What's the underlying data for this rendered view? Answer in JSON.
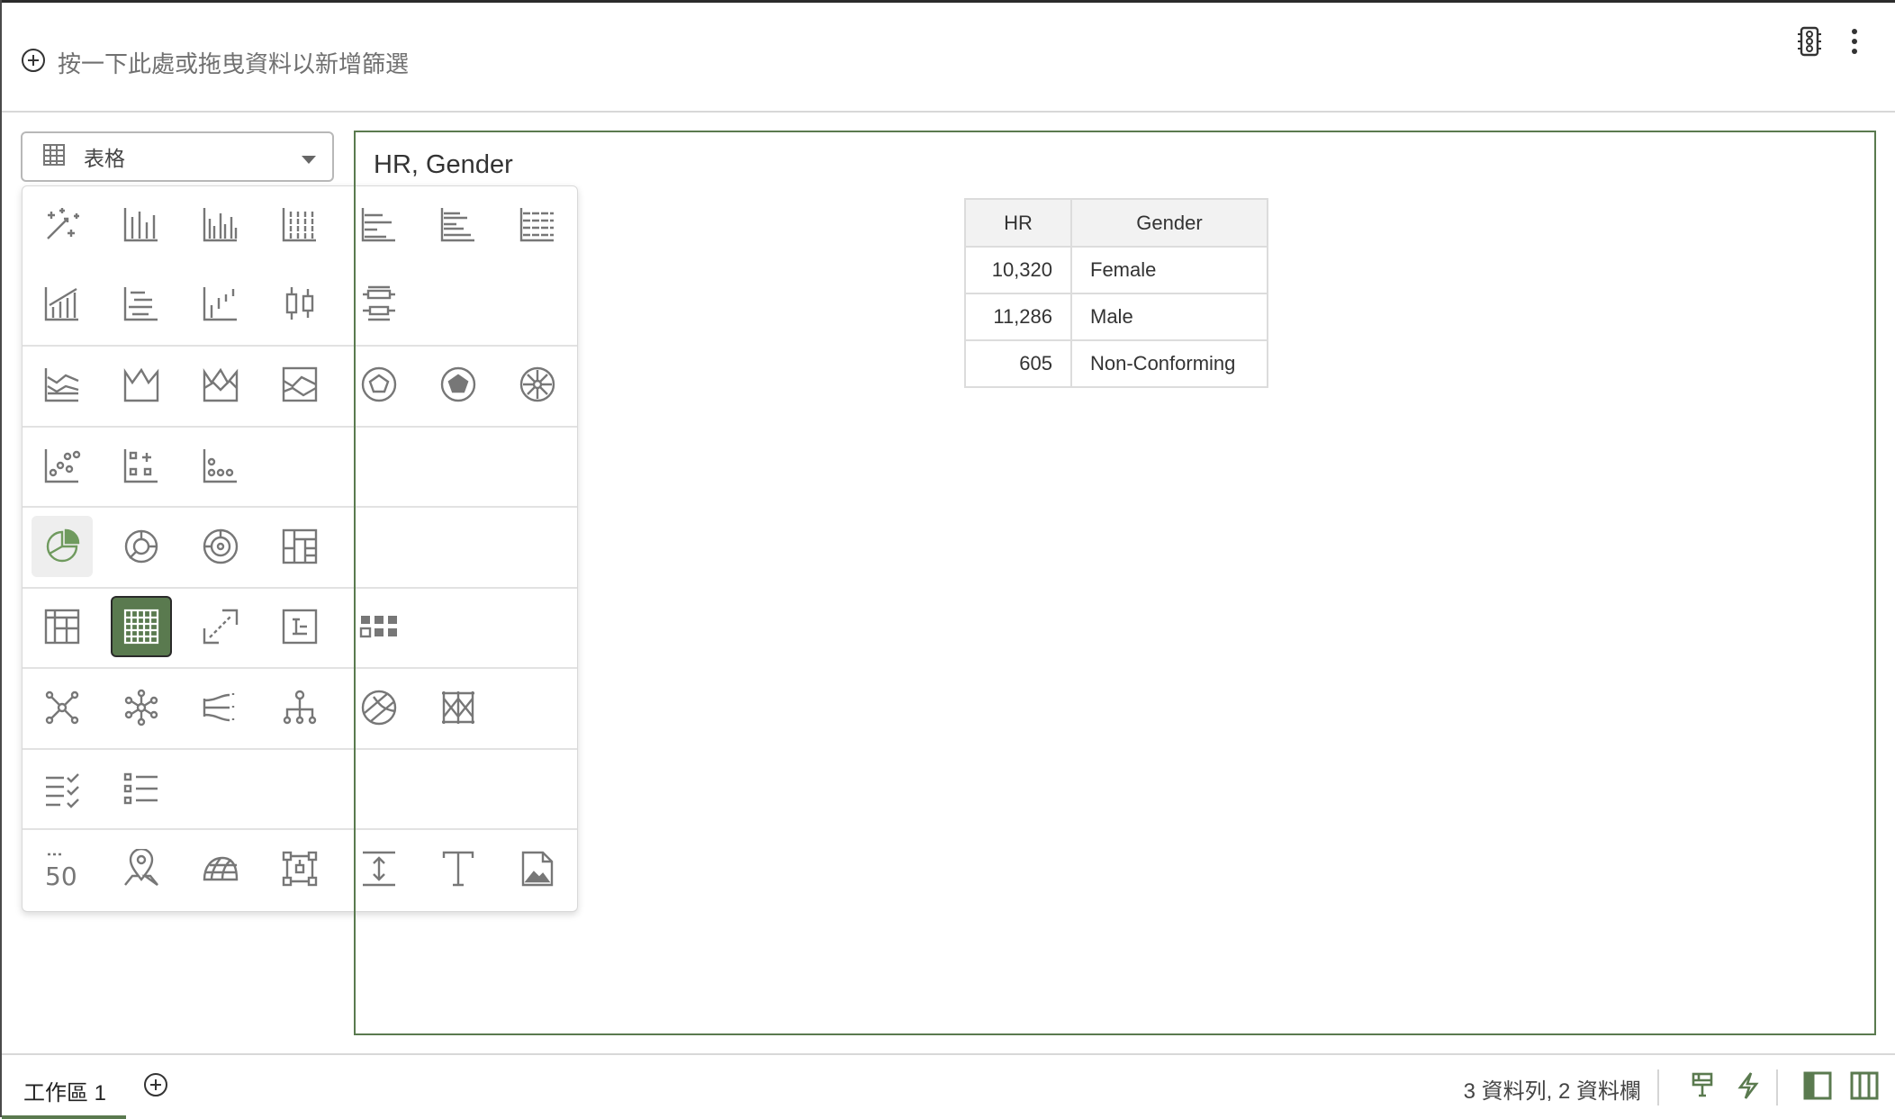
{
  "filter_bar": {
    "add_filter_text": "按一下此處或拖曳資料以新增篩選",
    "icons": [
      "add-circle-icon",
      "traffic-light-icon",
      "more-vertical-icon"
    ]
  },
  "viz_selector": {
    "selected_label": "表格",
    "icon": "table-grid-icon",
    "caret_icon": "chevron-down-icon"
  },
  "viz_panel": {
    "rows": [
      [
        "auto-visualization-icon",
        "bar-chart-icon",
        "grouped-bar-icon",
        "stacked-bar-icon",
        "horizontal-bar-icon",
        "horizontal-grouped-bar-icon",
        "horizontal-stacked-bar-icon"
      ],
      [
        "combo-bar-line-icon",
        "stacked-horizontal-variant-icon",
        "waterfall-icon",
        "boxplot-icon",
        "horizontal-boxplot-icon"
      ],
      [
        "line-chart-icon",
        "area-chart-icon",
        "stacked-area-icon",
        "percent-area-icon",
        "radar-pentagon-icon",
        "filled-radar-icon",
        "sunburst-wheel-icon"
      ],
      [
        "scatter-icon",
        "grid-scatter-icon",
        "dot-plot-icon"
      ],
      [
        "pie-chart-icon",
        "donut-chart-icon",
        "sunburst-icon",
        "treemap-icon"
      ],
      [
        "pivot-table-icon",
        "table-icon",
        "correlation-matrix-icon",
        "parallel-coordinates-icon",
        "tile-icon"
      ],
      [
        "network-icon",
        "chord-icon",
        "sankey-icon",
        "tree-diagram-icon",
        "circular-icon",
        "parallel-axis-icon"
      ],
      [
        "checklist-icon",
        "list-view-icon"
      ],
      [
        "performance-tile-icon",
        "map-icon",
        "heat-map-icon",
        "hierarchy-icon",
        "vertical-spacer-icon",
        "text-box-icon",
        "image-icon"
      ]
    ],
    "hover_icon": "pie-chart-icon",
    "selected_icon": "table-icon"
  },
  "canvas": {
    "title": "HR, Gender",
    "table": {
      "headers": [
        "HR",
        "Gender"
      ],
      "rows": [
        [
          "10,320",
          "Female"
        ],
        [
          "11,286",
          "Male"
        ],
        [
          "605",
          "Non-Conforming"
        ]
      ]
    }
  },
  "bottom_bar": {
    "tab_label": "工作區 1",
    "status": "3 資料列, 2 資料欄",
    "icons": [
      "add-tab-icon",
      "brush-icon",
      "lightning-icon",
      "left-panel-icon",
      "split-panel-icon"
    ],
    "accent_color": "#5a7a4f"
  }
}
